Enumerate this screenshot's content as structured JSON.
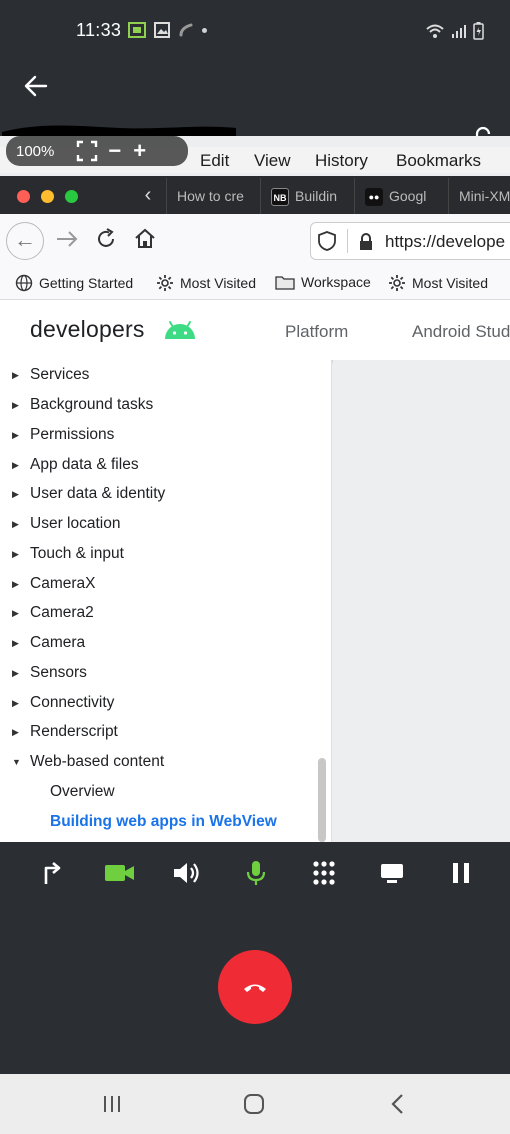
{
  "status_bar": {
    "time": "11:33",
    "icons": [
      "gallery-icon",
      "image-icon",
      "call-icon",
      "wifi-icon",
      "signal-icon",
      "battery-icon"
    ]
  },
  "remote": {
    "zoom": "100%",
    "zoom_minus": "−",
    "zoom_plus": "+",
    "menu": [
      "Edit",
      "View",
      "History",
      "Bookmarks"
    ],
    "tabs": [
      {
        "label": "How to cre",
        "icon": ""
      },
      {
        "label": "Buildin",
        "icon": "NB"
      },
      {
        "label": "Googl",
        "icon": "●●"
      },
      {
        "label": "Mini-XM",
        "icon": ""
      }
    ],
    "url": "https://develope",
    "bookmarks": [
      "Getting Started",
      "Most Visited",
      "Workspace",
      "Most Visited"
    ],
    "site": {
      "logo": "developers",
      "nav": [
        "Platform",
        "Android Stud"
      ]
    },
    "sidenav": {
      "items": [
        "Services",
        "Background tasks",
        "Permissions",
        "App data & files",
        "User data & identity",
        "User location",
        "Touch & input",
        "CameraX",
        "Camera2",
        "Camera",
        "Sensors",
        "Connectivity",
        "Renderscript",
        "Web-based content"
      ],
      "sub_items": [
        "Overview",
        "Building web apps in WebView"
      ]
    }
  },
  "call_controls": [
    "share-icon",
    "video-icon",
    "speaker-icon",
    "mic-icon",
    "keypad-icon",
    "screen-icon",
    "pause-icon"
  ],
  "colors": {
    "accent_green": "#6fcf3f",
    "end_call": "#ef2c36",
    "link_blue": "#1a73e8",
    "android_green": "#3ddc84"
  }
}
